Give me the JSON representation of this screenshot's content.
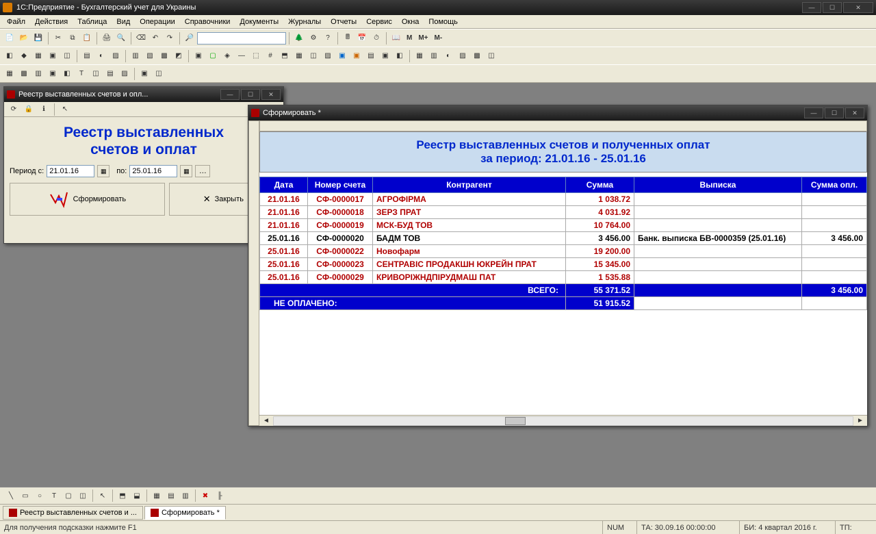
{
  "app": {
    "title": "1С:Предприятие - Бухгалтерский учет для Украины"
  },
  "menu": [
    "Файл",
    "Действия",
    "Таблица",
    "Вид",
    "Операции",
    "Справочники",
    "Документы",
    "Журналы",
    "Отчеты",
    "Сервис",
    "Окна",
    "Помощь"
  ],
  "toolbar_text": {
    "m1": "M",
    "m2": "M+",
    "m3": "M-"
  },
  "dialog": {
    "title": "Реестр выставленных счетов и опл...",
    "big_title_l1": "Реестр выставленных",
    "big_title_l2": "счетов и оплат",
    "period_from_label": "Период с:",
    "period_from": "21.01.16",
    "period_to_label": "по:",
    "period_to": "25.01.16",
    "btn_form": "Сформировать",
    "btn_close": "Закрыть"
  },
  "report": {
    "window_title": "Сформировать *",
    "header_l1": "Реестр выставленных счетов и полученных оплат",
    "header_l2": "за период: 21.01.16 - 25.01.16",
    "columns": {
      "date": "Дата",
      "num": "Номер счета",
      "agent": "Контрагент",
      "sum": "Сумма",
      "vyp": "Выписка",
      "sop": "Сумма опл."
    },
    "rows": [
      {
        "red": true,
        "date": "21.01.16",
        "num": "СФ-0000017",
        "agent": "АГРОФІРМА",
        "sum": "1 038.72",
        "vyp": "",
        "sop": ""
      },
      {
        "red": true,
        "date": "21.01.16",
        "num": "СФ-0000018",
        "agent": "ЗЕРЗ    ПРАТ",
        "sum": "4 031.92",
        "vyp": "",
        "sop": ""
      },
      {
        "red": true,
        "date": "21.01.16",
        "num": "СФ-0000019",
        "agent": "МСК-БУД ТОВ",
        "sum": "10 764.00",
        "vyp": "",
        "sop": ""
      },
      {
        "red": false,
        "date": "25.01.16",
        "num": "СФ-0000020",
        "agent": "БАДМ ТОВ",
        "sum": "3 456.00",
        "vyp": "Банк. выписка БВ-0000359 (25.01.16)",
        "sop": "3 456.00"
      },
      {
        "red": true,
        "date": "25.01.16",
        "num": "СФ-0000022",
        "agent": "Новофарм",
        "sum": "19 200.00",
        "vyp": "",
        "sop": ""
      },
      {
        "red": true,
        "date": "25.01.16",
        "num": "СФ-0000023",
        "agent": "СЕНТРАВІС ПРОДАКШН ЮКРЕЙН ПРАТ",
        "sum": "15 345.00",
        "vyp": "",
        "sop": ""
      },
      {
        "red": true,
        "date": "25.01.16",
        "num": "СФ-0000029",
        "agent": "КРИВОРІЖНДПІРУДМАШ ПАТ",
        "sum": "1 535.88",
        "vyp": "",
        "sop": ""
      }
    ],
    "total_label": "ВСЕГО:",
    "total_sum": "55 371.52",
    "total_sop": "3 456.00",
    "unpaid_label": "НЕ ОПЛАЧЕНО:",
    "unpaid_sum": "51 915.52"
  },
  "taskbar": {
    "tab1": "Реестр выставленных счетов и ...",
    "tab2": "Сформировать *"
  },
  "status": {
    "hint": "Для получения подсказки нажмите F1",
    "num": "NUM",
    "ta": "ТА: 30.09.16  00:00:00",
    "bi": "БИ: 4 квартал 2016 г.",
    "tp": "ТП:"
  }
}
